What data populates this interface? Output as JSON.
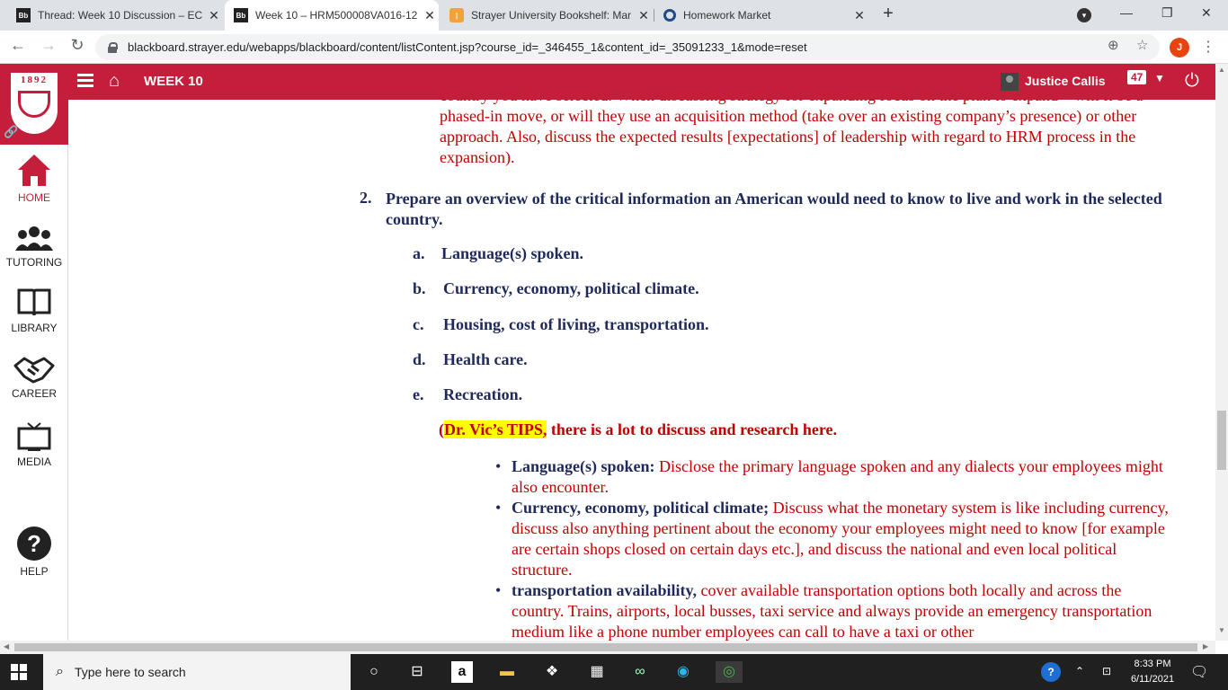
{
  "browser": {
    "tabs": [
      {
        "title": "Thread: Week 10 Discussion – EC",
        "icon": "blackboard-favicon"
      },
      {
        "title": "Week 10 – HRM500008VA016-12",
        "icon": "blackboard-favicon"
      },
      {
        "title": "Strayer University Bookshelf: Mar",
        "icon": "bookshelf-favicon"
      },
      {
        "title": "Homework Market",
        "icon": "homework-market-favicon"
      }
    ],
    "url": "blackboard.strayer.edu/webapps/blackboard/content/listContent.jsp?course_id=_346455_1&content_id=_35091233_1&mode=reset",
    "profile_initial": "J"
  },
  "header": {
    "title": "WEEK 10",
    "user_name": "Justice Callis",
    "notification_count": "47",
    "accent_color": "#c41e3a"
  },
  "sidebar": {
    "logo_year": "1892",
    "items": [
      {
        "label": "HOME",
        "icon": "home-icon"
      },
      {
        "label": "TUTORING",
        "icon": "people-icon"
      },
      {
        "label": "LIBRARY",
        "icon": "book-icon"
      },
      {
        "label": "CAREER",
        "icon": "handshake-icon"
      },
      {
        "label": "MEDIA",
        "icon": "tv-icon"
      },
      {
        "label": "HELP",
        "icon": "help-icon"
      }
    ]
  },
  "content": {
    "top_paragraph": "country you have selected. When discussing strategy for expanding focus on the plan to expand – will it be a phased-in move, or will they use an acquisition method (take over an existing company’s presence) or other approach. Also, discuss the expected results [expectations] of leadership with regard to HRM process in the expansion).",
    "item2_number": "2.",
    "item2_text": "Prepare an overview of the critical information an American would need to know to live and work in the selected country.",
    "subitems": [
      {
        "letter": "a.",
        "text": "Language(s) spoken."
      },
      {
        "letter": "b.",
        "text": "Currency, economy, political climate."
      },
      {
        "letter": "c.",
        "text": "Housing, cost of living, transportation."
      },
      {
        "letter": "d.",
        "text": "Health care."
      },
      {
        "letter": "e.",
        "text": "Recreation."
      }
    ],
    "tips_open": "(",
    "tips_highlight": "Dr. Vic’s TIPS,",
    "tips_rest": " there is a lot to discuss and research here.",
    "bullets": [
      {
        "lead": "Language(s) spoken:",
        "desc": " Disclose the primary language spoken and any dialects your employees might also encounter."
      },
      {
        "lead": "Currency, economy, political climate;",
        "desc": " Discuss what the monetary system is like including currency, discuss also anything pertinent about the economy your employees might need to know [for example are certain shops closed on certain days etc.], and discuss the national and even local political structure."
      },
      {
        "lead": "transportation availability,",
        "desc": " cover available transportation options both locally and across the country. Trains, airports, local busses, taxi service and always provide an emergency transportation medium like a phone number employees can call to have a taxi or other"
      }
    ]
  },
  "taskbar": {
    "search_placeholder": "Type here to search",
    "time": "8:33 PM",
    "date": "6/11/2021"
  }
}
